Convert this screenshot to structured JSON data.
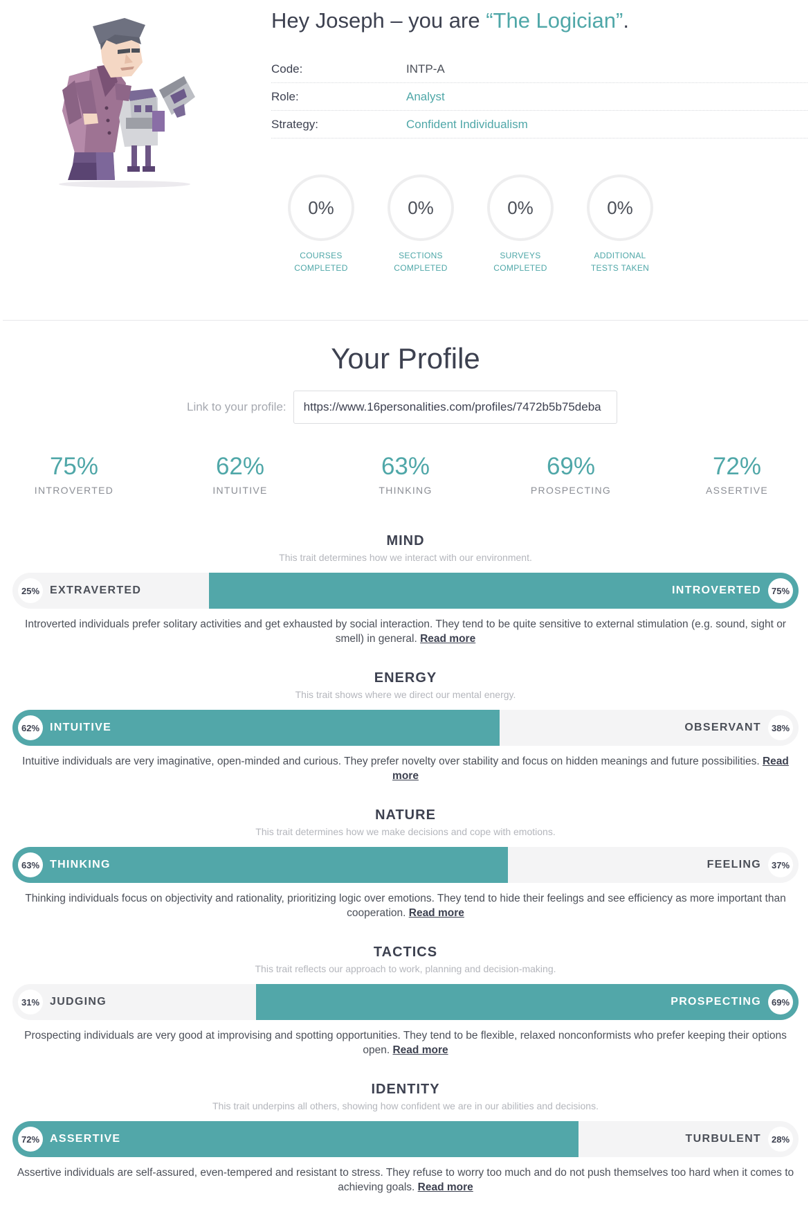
{
  "header": {
    "greeting": "Hey Joseph – you are ",
    "type_name": "“The Logician”",
    "period": "."
  },
  "info": [
    {
      "key": "Code:",
      "value": "INTP-A",
      "link": false
    },
    {
      "key": "Role:",
      "value": "Analyst",
      "link": true
    },
    {
      "key": "Strategy:",
      "value": "Confident Individualism",
      "link": true
    }
  ],
  "progress": [
    {
      "value": "0%",
      "label_1": "COURSES",
      "label_2": "COMPLETED"
    },
    {
      "value": "0%",
      "label_1": "SECTIONS",
      "label_2": "COMPLETED"
    },
    {
      "value": "0%",
      "label_1": "SURVEYS",
      "label_2": "COMPLETED"
    },
    {
      "value": "0%",
      "label_1": "ADDITIONAL",
      "label_2": "TESTS TAKEN"
    }
  ],
  "profile": {
    "title": "Your Profile",
    "link_label": "Link to your profile:",
    "link_value": "https://www.16personalities.com/profiles/7472b5b75deba"
  },
  "summary": [
    {
      "pct": "75%",
      "name": "INTROVERTED"
    },
    {
      "pct": "62%",
      "name": "INTUITIVE"
    },
    {
      "pct": "63%",
      "name": "THINKING"
    },
    {
      "pct": "69%",
      "name": "PROSPECTING"
    },
    {
      "pct": "72%",
      "name": "ASSERTIVE"
    }
  ],
  "traits": [
    {
      "title": "MIND",
      "subtitle": "This trait determines how we interact with our environment.",
      "left": {
        "label": "EXTRAVERTED",
        "pct": "25%"
      },
      "right": {
        "label": "INTROVERTED",
        "pct": "75%"
      },
      "dominant": "right",
      "fill_fraction": 0.75,
      "description": "Introverted individuals prefer solitary activities and get exhausted by social interaction. They tend to be quite sensitive to external stimulation (e.g. sound, sight or smell) in general. ",
      "read_more": "Read more"
    },
    {
      "title": "ENERGY",
      "subtitle": "This trait shows where we direct our mental energy.",
      "left": {
        "label": "INTUITIVE",
        "pct": "62%"
      },
      "right": {
        "label": "OBSERVANT",
        "pct": "38%"
      },
      "dominant": "left",
      "fill_fraction": 0.62,
      "description": "Intuitive individuals are very imaginative, open-minded and curious. They prefer novelty over stability and focus on hidden meanings and future possibilities. ",
      "read_more": "Read more"
    },
    {
      "title": "NATURE",
      "subtitle": "This trait determines how we make decisions and cope with emotions.",
      "left": {
        "label": "THINKING",
        "pct": "63%"
      },
      "right": {
        "label": "FEELING",
        "pct": "37%"
      },
      "dominant": "left",
      "fill_fraction": 0.63,
      "description": "Thinking individuals focus on objectivity and rationality, prioritizing logic over emotions. They tend to hide their feelings and see efficiency as more important than cooperation. ",
      "read_more": "Read more"
    },
    {
      "title": "TACTICS",
      "subtitle": "This trait reflects our approach to work, planning and decision-making.",
      "left": {
        "label": "JUDGING",
        "pct": "31%"
      },
      "right": {
        "label": "PROSPECTING",
        "pct": "69%"
      },
      "dominant": "right",
      "fill_fraction": 0.69,
      "description": "Prospecting individuals are very good at improvising and spotting opportunities. They tend to be flexible, relaxed nonconformists who prefer keeping their options open. ",
      "read_more": "Read more"
    },
    {
      "title": "IDENTITY",
      "subtitle": "This trait underpins all others, showing how confident we are in our abilities and decisions.",
      "left": {
        "label": "ASSERTIVE",
        "pct": "72%"
      },
      "right": {
        "label": "TURBULENT",
        "pct": "28%"
      },
      "dominant": "left",
      "fill_fraction": 0.72,
      "description": "Assertive individuals are self-assured, even-tempered and resistant to stress. They refuse to worry too much and do not push themselves too hard when it comes to achieving goals. ",
      "read_more": "Read more"
    }
  ],
  "colors": {
    "accent": "#4fa7a8",
    "bar_fill": "#52a7a9",
    "bar_track": "#f4f4f5",
    "heading": "#3d4150"
  },
  "icons": {
    "avatar": "logician-character-illustration"
  }
}
